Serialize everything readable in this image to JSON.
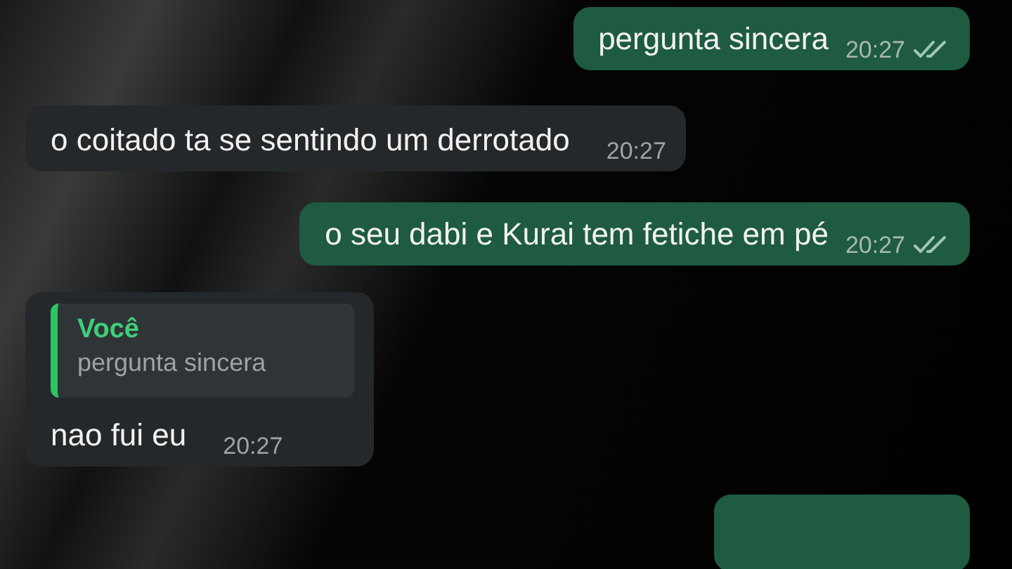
{
  "messages": [
    {
      "kind": "sent",
      "text": "pergunta sincera",
      "time": "20:27",
      "read": false
    },
    {
      "kind": "received",
      "text": "o coitado ta se sentindo um derrotado",
      "time": "20:27"
    },
    {
      "kind": "sent",
      "text": "o seu dabi e Kurai tem fetiche em pé",
      "time": "20:27",
      "read": false
    },
    {
      "kind": "received",
      "text": "nao fui eu",
      "time": "20:27",
      "quote": {
        "author": "Você",
        "text": "pergunta sincera"
      }
    }
  ]
}
